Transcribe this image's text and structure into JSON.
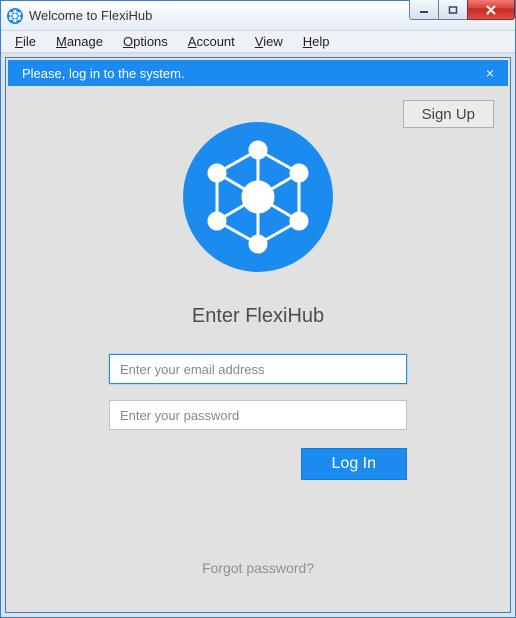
{
  "window": {
    "title": "Welcome to FlexiHub"
  },
  "menu": {
    "file": "File",
    "manage": "Manage",
    "options": "Options",
    "account": "Account",
    "view": "View",
    "help": "Help"
  },
  "notification": {
    "text": "Please, log in to the system.",
    "close": "×"
  },
  "signup": {
    "label": "Sign Up"
  },
  "heading": "Enter FlexiHub",
  "form": {
    "email_placeholder": "Enter your email address",
    "password_placeholder": "Enter your password",
    "login_label": "Log In"
  },
  "forgot": "Forgot password?",
  "colors": {
    "accent": "#1b8bf0",
    "window_border": "#2f82d6",
    "bg": "#e1e1e1"
  }
}
